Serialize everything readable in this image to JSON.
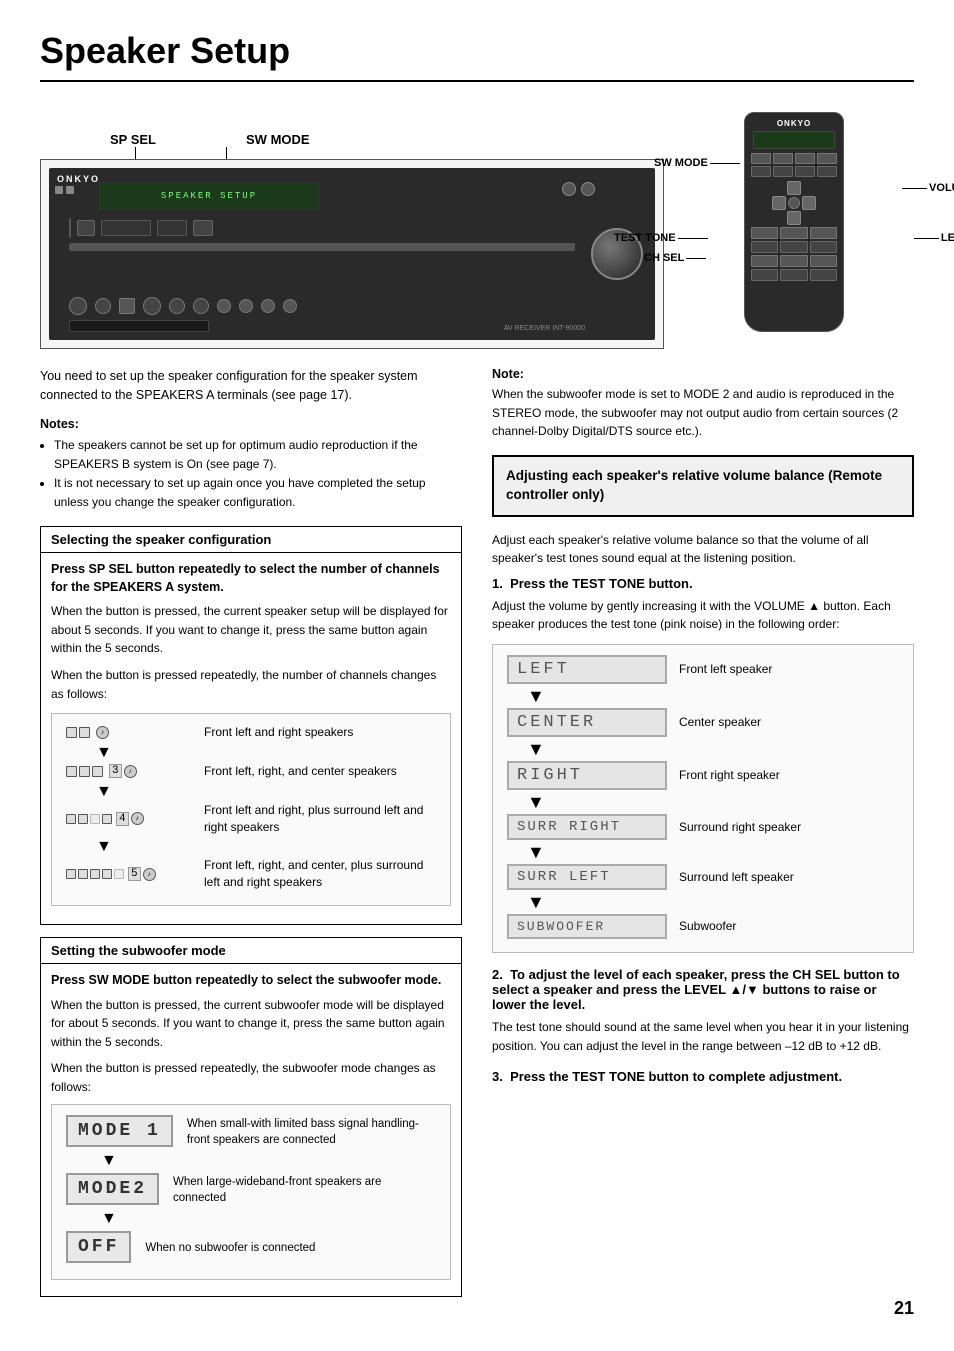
{
  "page": {
    "title": "Speaker Setup",
    "page_number": "21"
  },
  "diagram": {
    "label_sp_sel": "SP SEL",
    "label_sw_mode": "SW MODE",
    "label_sw_mode_remote": "SW MODE",
    "label_volume": "VOLUME ▲/▼",
    "label_test_tone": "TEST TONE",
    "label_ch_sel": "CH SEL",
    "label_level": "LEVEL ▲/▼",
    "brand": "ONKYO"
  },
  "intro": {
    "text": "You need to set up the speaker configuration for the speaker system connected to the SPEAKERS A terminals (see page 17)."
  },
  "notes": {
    "title": "Notes:",
    "items": [
      "The speakers cannot be set up for optimum audio reproduction if the SPEAKERS B system is On (see page 7).",
      "It is not necessary to set up again once you have completed the setup unless you change the speaker configuration."
    ]
  },
  "selecting_section": {
    "header": "Selecting the speaker configuration",
    "instruction_bold": "Press SP SEL button repeatedly to select the number of channels for the SPEAKERS A system.",
    "text1": "When the button is pressed, the current speaker setup will be displayed for about 5 seconds. If you want to change it, press the same button again within the 5 seconds.",
    "text2": "When the button is pressed repeatedly, the number of channels changes as follows:",
    "config_rows": [
      {
        "icons": "2spk+sub",
        "description": "Front left and right speakers"
      },
      {
        "icons": "3spk+sub",
        "description": "Front left, right, and center speakers"
      },
      {
        "icons": "4spk+sub",
        "description": "Front left and right, plus surround left and right speakers"
      },
      {
        "icons": "5spk+sub",
        "description": "Front left, right, and center, plus surround left and right speakers"
      }
    ]
  },
  "subwoofer_section": {
    "header": "Setting the subwoofer mode",
    "instruction_bold": "Press SW MODE button repeatedly to select the subwoofer mode.",
    "text1": "When the button is pressed, the current subwoofer mode will be displayed for about 5 seconds. If you want to change it, press the same button again within the 5 seconds.",
    "text2": "When the button is pressed repeatedly, the subwoofer mode changes as follows:",
    "modes": [
      {
        "display": "MODE 1",
        "description": "When small-with limited bass signal handling-front speakers  are connected"
      },
      {
        "display": "MODE2",
        "description": "When large-wideband-front speakers are connected"
      },
      {
        "display": "OFF",
        "description": "When no subwoofer is connected"
      }
    ]
  },
  "adjusting_section": {
    "header": "Adjusting each speaker's relative volume balance (Remote controller only)",
    "intro_text": "Adjust each speaker's relative volume balance so that the volume of all speaker's test tones sound equal at the listening position.",
    "steps": [
      {
        "number": "1.",
        "title": "Press the TEST TONE button.",
        "body": "Adjust the volume by gently increasing it with the VOLUME ▲ button. Each speaker produces the test tone (pink noise) in the following order:"
      },
      {
        "number": "2.",
        "title": "To adjust the level of each speaker, press the CH SEL button to select a speaker and press the LEVEL ▲/▼ buttons to raise or lower the level.",
        "body": "The test tone should sound at the same level when you hear it in your listening position. You can adjust the level in the range between –12 dB to +12 dB."
      },
      {
        "number": "3.",
        "title": "Press the TEST TONE button to complete adjustment.",
        "body": ""
      }
    ],
    "speaker_sequence": [
      {
        "display": "LEFT",
        "description": "Front left speaker"
      },
      {
        "display": "CENTER",
        "description": "Center speaker"
      },
      {
        "display": "RIGHT",
        "description": "Front right speaker"
      },
      {
        "display": "SURR RIGHT",
        "description": "Surround right speaker"
      },
      {
        "display": "SURR LEFT",
        "description": "Surround left speaker"
      },
      {
        "display": "SUBWOOFER",
        "description": "Subwoofer"
      }
    ]
  },
  "note_right": {
    "title": "Note:",
    "body": "When the subwoofer mode is set to MODE 2 and audio is reproduced in the STEREO mode, the subwoofer may not output audio from certain sources (2 channel-Dolby Digital/DTS source etc.)."
  }
}
